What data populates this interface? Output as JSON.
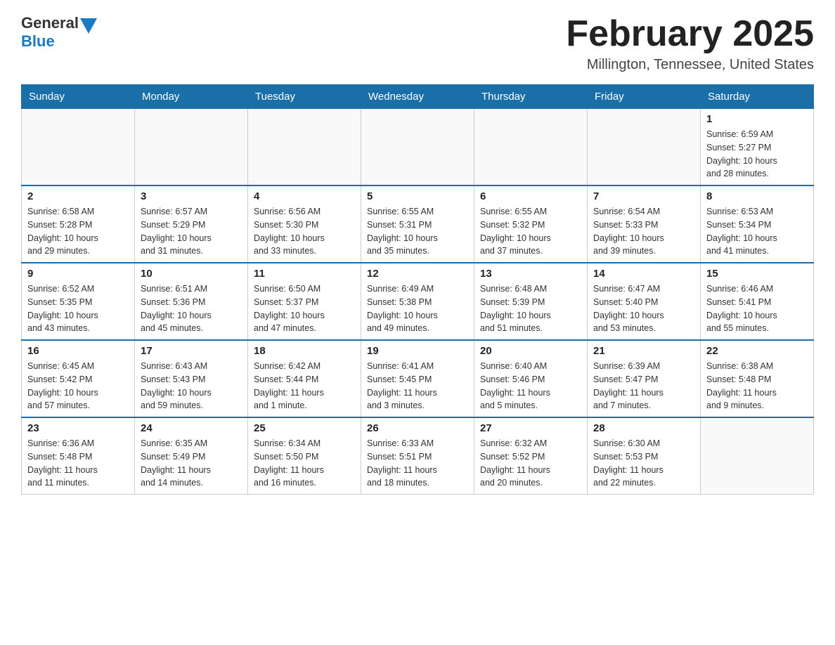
{
  "header": {
    "logo_general": "General",
    "logo_blue": "Blue",
    "month_title": "February 2025",
    "location": "Millington, Tennessee, United States"
  },
  "days_of_week": [
    "Sunday",
    "Monday",
    "Tuesday",
    "Wednesday",
    "Thursday",
    "Friday",
    "Saturday"
  ],
  "weeks": [
    [
      {
        "day": "",
        "info": ""
      },
      {
        "day": "",
        "info": ""
      },
      {
        "day": "",
        "info": ""
      },
      {
        "day": "",
        "info": ""
      },
      {
        "day": "",
        "info": ""
      },
      {
        "day": "",
        "info": ""
      },
      {
        "day": "1",
        "info": "Sunrise: 6:59 AM\nSunset: 5:27 PM\nDaylight: 10 hours\nand 28 minutes."
      }
    ],
    [
      {
        "day": "2",
        "info": "Sunrise: 6:58 AM\nSunset: 5:28 PM\nDaylight: 10 hours\nand 29 minutes."
      },
      {
        "day": "3",
        "info": "Sunrise: 6:57 AM\nSunset: 5:29 PM\nDaylight: 10 hours\nand 31 minutes."
      },
      {
        "day": "4",
        "info": "Sunrise: 6:56 AM\nSunset: 5:30 PM\nDaylight: 10 hours\nand 33 minutes."
      },
      {
        "day": "5",
        "info": "Sunrise: 6:55 AM\nSunset: 5:31 PM\nDaylight: 10 hours\nand 35 minutes."
      },
      {
        "day": "6",
        "info": "Sunrise: 6:55 AM\nSunset: 5:32 PM\nDaylight: 10 hours\nand 37 minutes."
      },
      {
        "day": "7",
        "info": "Sunrise: 6:54 AM\nSunset: 5:33 PM\nDaylight: 10 hours\nand 39 minutes."
      },
      {
        "day": "8",
        "info": "Sunrise: 6:53 AM\nSunset: 5:34 PM\nDaylight: 10 hours\nand 41 minutes."
      }
    ],
    [
      {
        "day": "9",
        "info": "Sunrise: 6:52 AM\nSunset: 5:35 PM\nDaylight: 10 hours\nand 43 minutes."
      },
      {
        "day": "10",
        "info": "Sunrise: 6:51 AM\nSunset: 5:36 PM\nDaylight: 10 hours\nand 45 minutes."
      },
      {
        "day": "11",
        "info": "Sunrise: 6:50 AM\nSunset: 5:37 PM\nDaylight: 10 hours\nand 47 minutes."
      },
      {
        "day": "12",
        "info": "Sunrise: 6:49 AM\nSunset: 5:38 PM\nDaylight: 10 hours\nand 49 minutes."
      },
      {
        "day": "13",
        "info": "Sunrise: 6:48 AM\nSunset: 5:39 PM\nDaylight: 10 hours\nand 51 minutes."
      },
      {
        "day": "14",
        "info": "Sunrise: 6:47 AM\nSunset: 5:40 PM\nDaylight: 10 hours\nand 53 minutes."
      },
      {
        "day": "15",
        "info": "Sunrise: 6:46 AM\nSunset: 5:41 PM\nDaylight: 10 hours\nand 55 minutes."
      }
    ],
    [
      {
        "day": "16",
        "info": "Sunrise: 6:45 AM\nSunset: 5:42 PM\nDaylight: 10 hours\nand 57 minutes."
      },
      {
        "day": "17",
        "info": "Sunrise: 6:43 AM\nSunset: 5:43 PM\nDaylight: 10 hours\nand 59 minutes."
      },
      {
        "day": "18",
        "info": "Sunrise: 6:42 AM\nSunset: 5:44 PM\nDaylight: 11 hours\nand 1 minute."
      },
      {
        "day": "19",
        "info": "Sunrise: 6:41 AM\nSunset: 5:45 PM\nDaylight: 11 hours\nand 3 minutes."
      },
      {
        "day": "20",
        "info": "Sunrise: 6:40 AM\nSunset: 5:46 PM\nDaylight: 11 hours\nand 5 minutes."
      },
      {
        "day": "21",
        "info": "Sunrise: 6:39 AM\nSunset: 5:47 PM\nDaylight: 11 hours\nand 7 minutes."
      },
      {
        "day": "22",
        "info": "Sunrise: 6:38 AM\nSunset: 5:48 PM\nDaylight: 11 hours\nand 9 minutes."
      }
    ],
    [
      {
        "day": "23",
        "info": "Sunrise: 6:36 AM\nSunset: 5:48 PM\nDaylight: 11 hours\nand 11 minutes."
      },
      {
        "day": "24",
        "info": "Sunrise: 6:35 AM\nSunset: 5:49 PM\nDaylight: 11 hours\nand 14 minutes."
      },
      {
        "day": "25",
        "info": "Sunrise: 6:34 AM\nSunset: 5:50 PM\nDaylight: 11 hours\nand 16 minutes."
      },
      {
        "day": "26",
        "info": "Sunrise: 6:33 AM\nSunset: 5:51 PM\nDaylight: 11 hours\nand 18 minutes."
      },
      {
        "day": "27",
        "info": "Sunrise: 6:32 AM\nSunset: 5:52 PM\nDaylight: 11 hours\nand 20 minutes."
      },
      {
        "day": "28",
        "info": "Sunrise: 6:30 AM\nSunset: 5:53 PM\nDaylight: 11 hours\nand 22 minutes."
      },
      {
        "day": "",
        "info": ""
      }
    ]
  ]
}
